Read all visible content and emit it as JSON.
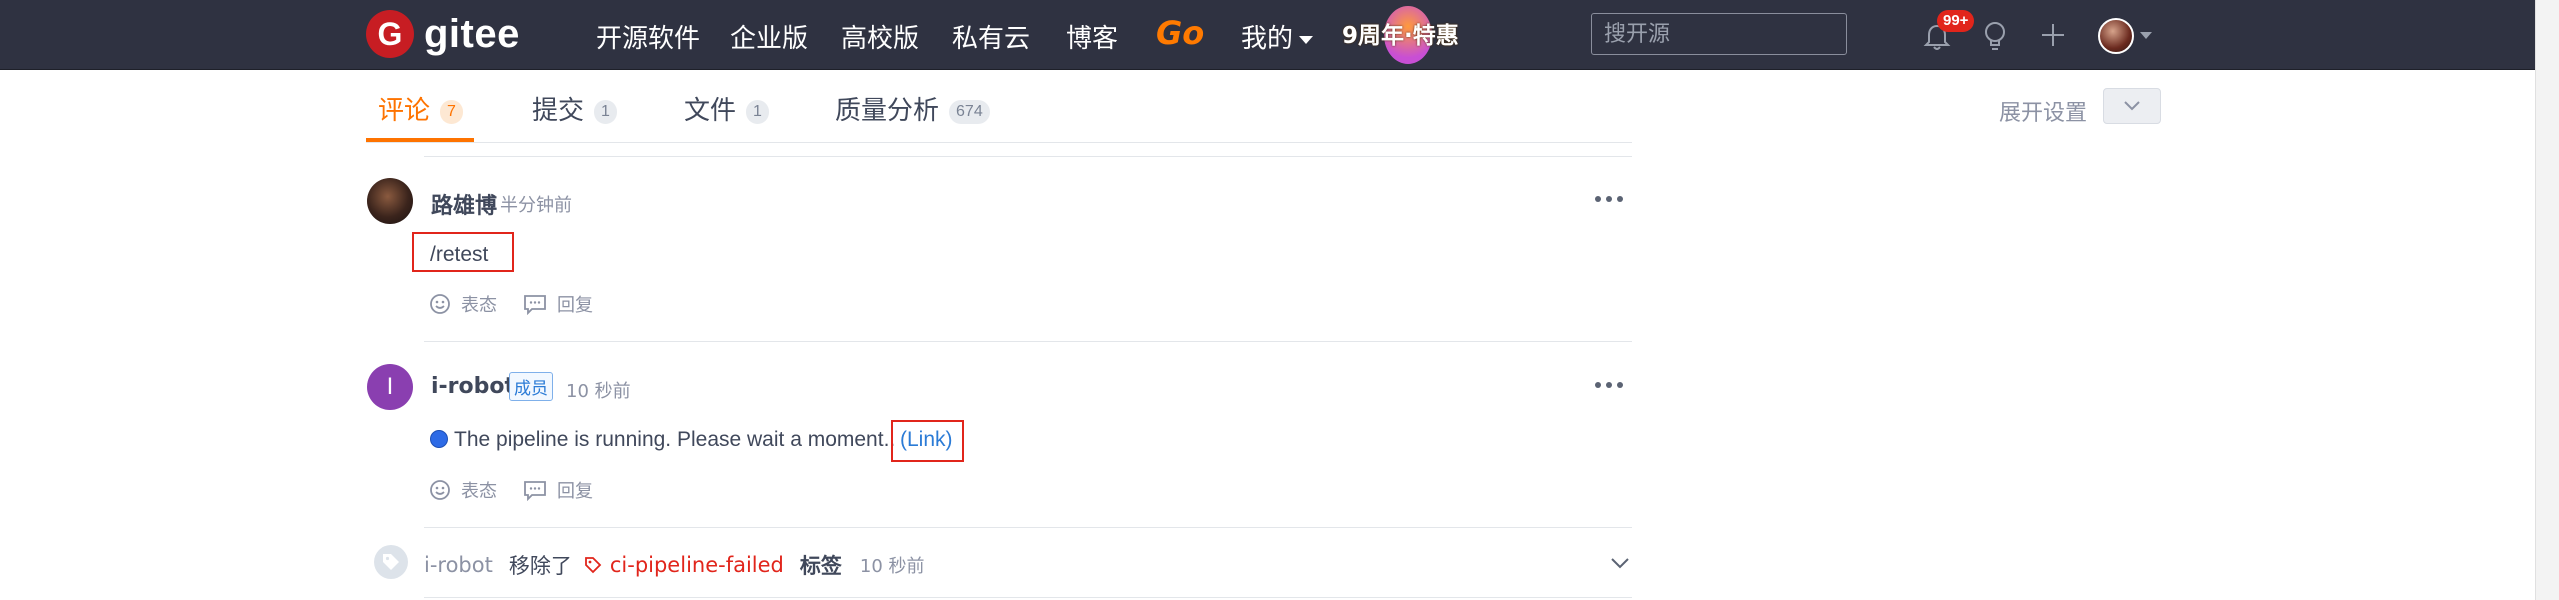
{
  "nav": {
    "brand": "gitee",
    "logo_letter": "G",
    "items": [
      "开源软件",
      "企业版",
      "高校版",
      "私有云",
      "博客"
    ],
    "go": "Go",
    "mine": "我的",
    "anniversary": "9周年·特惠",
    "search_placeholder": "搜开源",
    "notification_badge": "99+",
    "accent_color": "#fe7300"
  },
  "tabs": [
    {
      "label": "评论",
      "count": "7",
      "active": true
    },
    {
      "label": "提交",
      "count": "1",
      "active": false
    },
    {
      "label": "文件",
      "count": "1",
      "active": false
    },
    {
      "label": "质量分析",
      "count": "674",
      "active": false
    }
  ],
  "settings": {
    "expand_label": "展开设置"
  },
  "comments": [
    {
      "author": "路雄博",
      "time": "半分钟前",
      "body": "/retest",
      "actions": {
        "react": "表态",
        "reply": "回复"
      }
    },
    {
      "author": "i-robot",
      "avatar_letter": "I",
      "role": "成员",
      "time": "10 秒前",
      "body": "The pipeline is running. Please wait a moment..",
      "link_text": "(Link)",
      "actions": {
        "react": "表态",
        "reply": "回复"
      }
    }
  ],
  "event": {
    "user": "i-robot",
    "verb": "移除了",
    "label": "ci-pipeline-failed",
    "noun": "标签",
    "time": "10 秒前"
  }
}
